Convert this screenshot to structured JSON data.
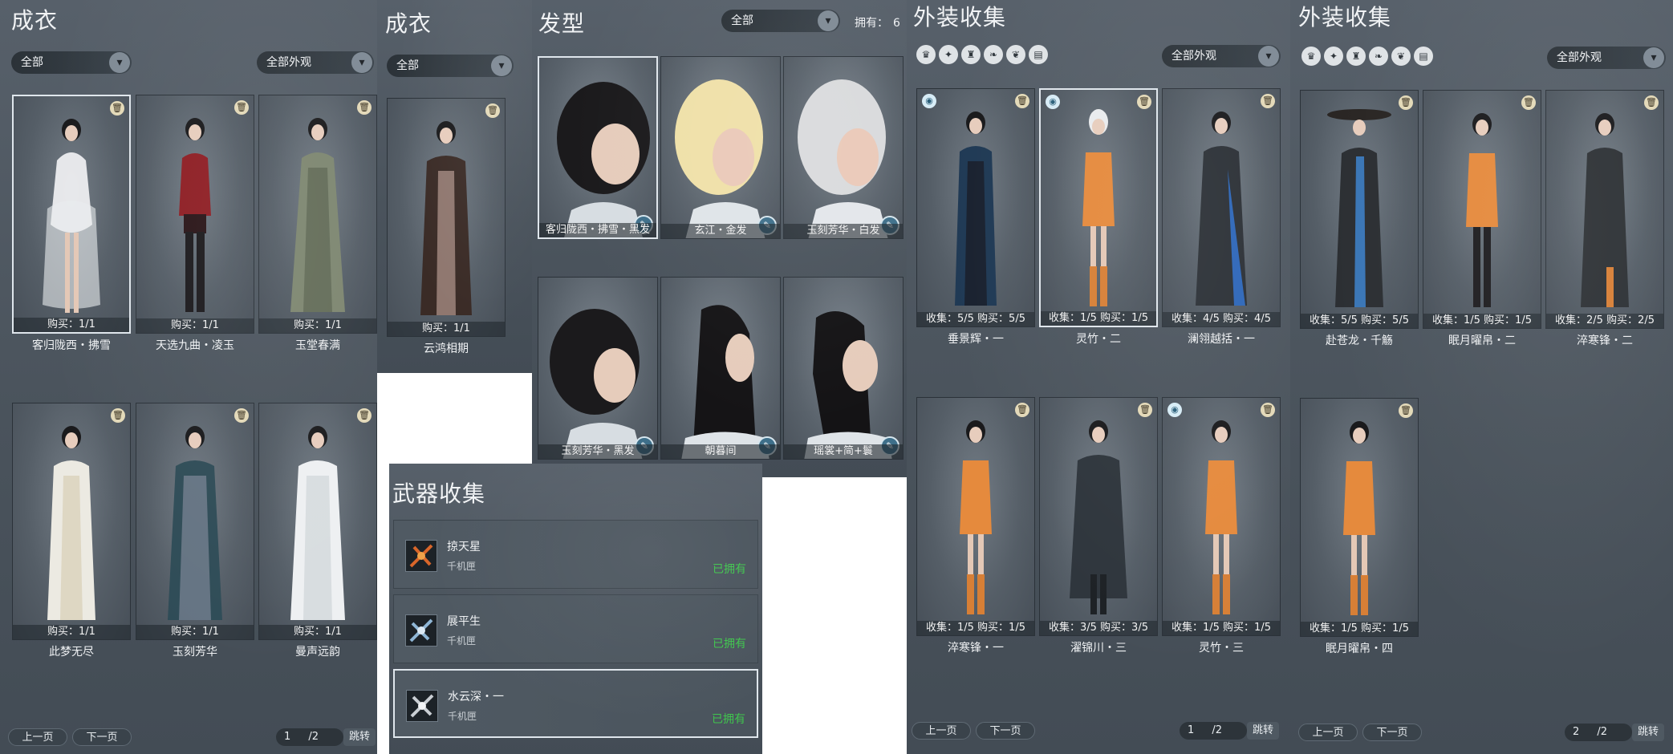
{
  "p1": {
    "title": "成衣",
    "filter_left": "全部",
    "filter_right": "全部外观",
    "cards": [
      {
        "stat": "购买：1/1",
        "name": "客归陇西・拂雪"
      },
      {
        "stat": "购买：1/1",
        "name": "天选九曲・凌玉"
      },
      {
        "stat": "购买：1/1",
        "name": "玉堂春满"
      },
      {
        "stat": "购买：1/1",
        "name": "此梦无尽"
      },
      {
        "stat": "购买：1/1",
        "name": "玉刻芳华"
      },
      {
        "stat": "购买：1/1",
        "name": "曼声远韵"
      }
    ],
    "pager": {
      "prev": "上一页",
      "next": "下一页",
      "page": "1",
      "total": "/2",
      "jump": "跳转"
    }
  },
  "p2": {
    "title": "成衣",
    "filter": "全部",
    "cards": [
      {
        "stat": "购买：1/1",
        "name": "云鸿相期"
      }
    ]
  },
  "p3": {
    "title": "发型",
    "filter": "全部",
    "owned_label": "拥有：",
    "owned_count": "6",
    "items": [
      {
        "label": "客归陇西・拂雪・黑发"
      },
      {
        "label": "玄江・金发"
      },
      {
        "label": "玉刻芳华・白发"
      },
      {
        "label": "玉刻芳华・黑发"
      },
      {
        "label": "朝暮间"
      },
      {
        "label": "瑶裳+简+鬟"
      }
    ]
  },
  "p4": {
    "title": "武器收集",
    "weapons": [
      {
        "name": "掠天星",
        "sub": "千机匣",
        "status": "已拥有"
      },
      {
        "name": "展平生",
        "sub": "千机匣",
        "status": "已拥有"
      },
      {
        "name": "水云深・一",
        "sub": "千机匣",
        "status": "已拥有"
      }
    ]
  },
  "p5": {
    "title": "外装收集",
    "filter": "全部外观",
    "cards": [
      {
        "stat": "收集：5/5  购买：5/5",
        "name": "垂景辉・一"
      },
      {
        "stat": "收集：1/5  购买：1/5",
        "name": "灵竹・二"
      },
      {
        "stat": "收集：4/5  购买：4/5",
        "name": "澜翎越括・一"
      },
      {
        "stat": "收集：1/5  购买：1/5",
        "name": "淬寒锋・一"
      },
      {
        "stat": "收集：3/5  购买：3/5",
        "name": "濯锦川・三"
      },
      {
        "stat": "收集：1/5  购买：1/5",
        "name": "灵竹・三"
      }
    ],
    "pager": {
      "prev": "上一页",
      "next": "下一页",
      "page": "1",
      "total": "/2",
      "jump": "跳转"
    }
  },
  "p6": {
    "title": "外装收集",
    "filter": "全部外观",
    "cards": [
      {
        "stat": "收集：5/5  购买：5/5",
        "name": "赴苍龙・千觞"
      },
      {
        "stat": "收集：1/5  购买：1/5",
        "name": "眠月曜帛・二"
      },
      {
        "stat": "收集：2/5  购买：2/5",
        "name": "淬寒锋・二"
      },
      {
        "stat": "收集：1/5  购买：1/5",
        "name": "眠月曜帛・四"
      }
    ],
    "pager": {
      "prev": "上一页",
      "next": "下一页",
      "page": "2",
      "total": "/2",
      "jump": "跳转"
    }
  },
  "icons": {
    "trash": "trash-icon",
    "chevron": "chevron-down-icon",
    "brush": "dye-brush-icon"
  }
}
